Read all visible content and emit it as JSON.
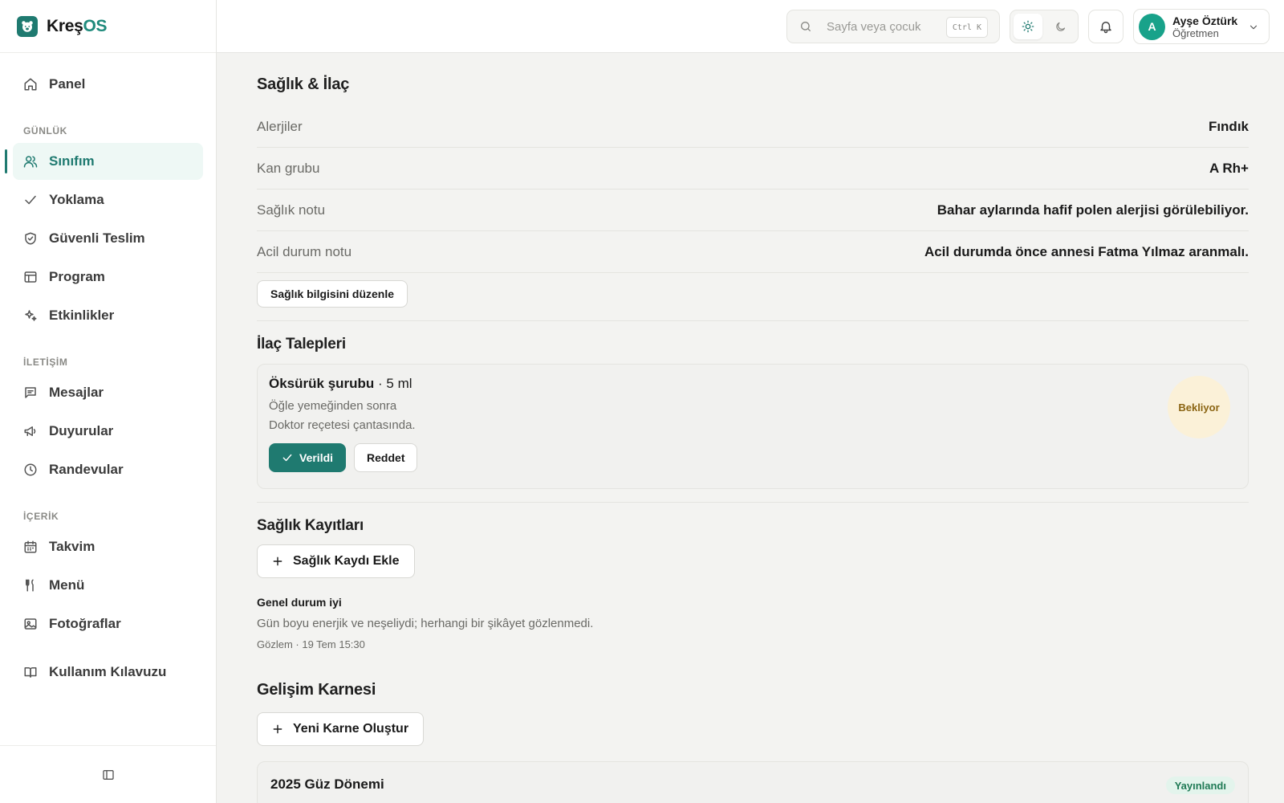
{
  "brand": {
    "name_main": "Kreş",
    "name_accent": "OS"
  },
  "colors": {
    "accent": "#1f7a70",
    "pending_bg": "#fbf1d8",
    "published_bg": "#e3f4ec"
  },
  "sidebar": {
    "top_item": {
      "label": "Panel",
      "icon": "home-icon"
    },
    "sections": [
      {
        "title": "GÜNLÜK",
        "items": [
          {
            "label": "Sınıfım",
            "icon": "users-icon",
            "active": true
          },
          {
            "label": "Yoklama",
            "icon": "check-icon"
          },
          {
            "label": "Güvenli Teslim",
            "icon": "shield-check-icon"
          },
          {
            "label": "Program",
            "icon": "table-icon"
          },
          {
            "label": "Etkinlikler",
            "icon": "sparkles-icon"
          }
        ]
      },
      {
        "title": "İLETİŞİM",
        "items": [
          {
            "label": "Mesajlar",
            "icon": "message-icon"
          },
          {
            "label": "Duyurular",
            "icon": "megaphone-icon"
          },
          {
            "label": "Randevular",
            "icon": "clock-icon"
          }
        ]
      },
      {
        "title": "İÇERİK",
        "items": [
          {
            "label": "Takvim",
            "icon": "calendar-icon"
          },
          {
            "label": "Menü",
            "icon": "utensils-icon"
          },
          {
            "label": "Fotoğraflar",
            "icon": "image-icon"
          }
        ]
      }
    ],
    "guide": {
      "label": "Kullanım Kılavuzu",
      "icon": "book-icon"
    }
  },
  "topbar": {
    "search_placeholder": "Sayfa veya çocuk",
    "shortcut": "Ctrl K",
    "user": {
      "initial": "A",
      "name": "Ayşe Öztürk",
      "role": "Öğretmen"
    }
  },
  "health": {
    "title": "Sağlık & İlaç",
    "rows": [
      {
        "label": "Alerjiler",
        "value": "Fındık"
      },
      {
        "label": "Kan grubu",
        "value": "A Rh+"
      },
      {
        "label": "Sağlık notu",
        "value": "Bahar aylarında hafif polen alerjisi görülebiliyor."
      },
      {
        "label": "Acil durum notu",
        "value": "Acil durumda önce annesi Fatma Yılmaz aranmalı."
      }
    ],
    "edit_button": "Sağlık bilgisini düzenle"
  },
  "medications": {
    "title": "İlaç Talepleri",
    "request": {
      "name": "Öksürük şurubu",
      "dose": " · 5 ml",
      "timing": "Öğle yemeğinden sonra",
      "note": "Doktor reçetesi çantasında.",
      "status": "Bekliyor",
      "given_button": "Verildi",
      "reject_button": "Reddet"
    }
  },
  "records": {
    "title": "Sağlık Kayıtları",
    "add_button": "Sağlık Kaydı Ekle",
    "items": [
      {
        "title": "Genel durum iyi",
        "description": "Gün boyu enerjik ve neşeliydi; herhangi bir şikâyet gözlenmedi.",
        "meta": "Gözlem · 19 Tem 15:30"
      }
    ]
  },
  "development": {
    "title": "Gelişim Karnesi",
    "new_button": "Yeni Karne Oluştur",
    "reports": [
      {
        "title": "2025 Güz Dönemi",
        "status": "Yayınlandı"
      }
    ]
  }
}
